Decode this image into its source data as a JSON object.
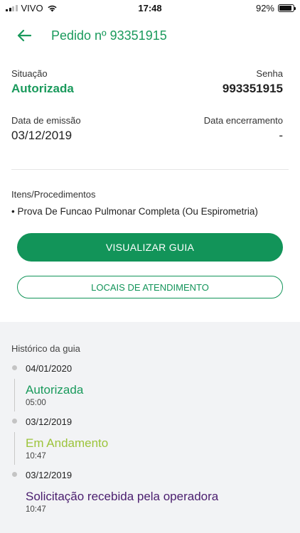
{
  "status_bar": {
    "carrier": "VIVO",
    "time": "17:48",
    "battery": "92%",
    "battery_level": 0.92
  },
  "header": {
    "title": "Pedido nº 93351915"
  },
  "order": {
    "situacao_label": "Situação",
    "situacao_value": "Autorizada",
    "senha_label": "Senha",
    "senha_value": "993351915",
    "emissao_label": "Data de emissão",
    "emissao_value": "03/12/2019",
    "encerramento_label": "Data encerramento",
    "encerramento_value": "-"
  },
  "items": {
    "label": "Itens/Procedimentos",
    "list": [
      "• Prova De Funcao Pulmonar Completa (Ou Espirometria)"
    ]
  },
  "buttons": {
    "primary": "VISUALIZAR GUIA",
    "secondary": "LOCAIS DE ATENDIMENTO"
  },
  "history": {
    "label": "Histórico da guia",
    "entries": [
      {
        "date": "04/01/2020",
        "status": "Autorizada",
        "time": "05:00",
        "color": "#1a9a5c"
      },
      {
        "date": "03/12/2019",
        "status": "Em Andamento",
        "time": "10:47",
        "color": "#9cc43a"
      },
      {
        "date": "03/12/2019",
        "status": "Solicitação recebida pela operadora",
        "time": "10:47",
        "color": "#4a1d6e"
      }
    ]
  },
  "colors": {
    "brand_green": "#129459",
    "status_green": "#1a9a5c",
    "status_lime": "#9cc43a",
    "status_purple": "#4a1d6e"
  }
}
